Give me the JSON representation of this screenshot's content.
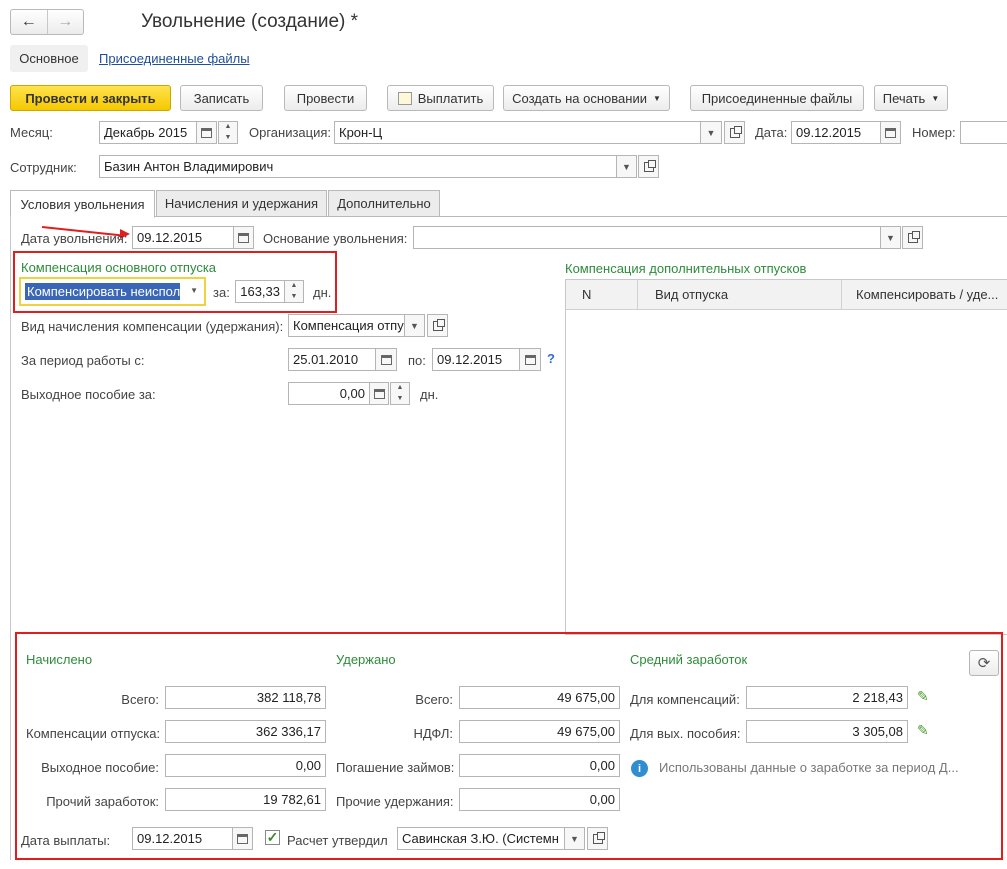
{
  "nav": {
    "back": "←",
    "forward": "→"
  },
  "title": "Увольнение (создание) *",
  "section_tabs": {
    "main": "Основное",
    "files": "Присоединенные файлы"
  },
  "toolbar": {
    "post_close": "Провести и закрыть",
    "save": "Записать",
    "post": "Провести",
    "pay": "Выплатить",
    "create_based": "Создать на основании",
    "attached_files": "Присоединенные файлы",
    "print": "Печать"
  },
  "header": {
    "month_label": "Месяц:",
    "month_value": "Декабрь 2015",
    "org_label": "Организация:",
    "org_value": "Крон-Ц",
    "date_label": "Дата:",
    "date_value": "09.12.2015",
    "number_label": "Номер:",
    "number_value": "",
    "employee_label": "Сотрудник:",
    "employee_value": "Базин Антон Владимирович"
  },
  "tabs": [
    "Условия увольнения",
    "Начисления и удержания",
    "Дополнительно"
  ],
  "conditions": {
    "dismissal_date_label": "Дата увольнения:",
    "dismissal_date_value": "09.12.2015",
    "basis_label": "Основание увольнения:",
    "basis_value": "",
    "main_vacation_title": "Компенсация основного отпуска",
    "compensate_value": "Компенсировать неиспол",
    "for_label": "за:",
    "days_value": "163,33",
    "days_unit": "дн.",
    "accrual_type_label": "Вид начисления компенсации (удержания):",
    "accrual_type_value": "Компенсация отпус",
    "period_from_label": "За период работы с:",
    "period_from_value": "25.01.2010",
    "period_to_label": "по:",
    "period_to_value": "09.12.2015",
    "help": "?",
    "severance_label": "Выходное пособие за:",
    "severance_value": "0,00",
    "severance_unit": "дн."
  },
  "extra_vacations": {
    "title": "Компенсация дополнительных отпусков",
    "columns": [
      "N",
      "Вид отпуска",
      "Компенсировать / уде..."
    ]
  },
  "accrued": {
    "title": "Начислено",
    "total_label": "Всего:",
    "total_value": "382 118,78",
    "vacation_label": "Компенсации отпуска:",
    "vacation_value": "362 336,17",
    "severance_label": "Выходное пособие:",
    "severance_value": "0,00",
    "other_label": "Прочий заработок:",
    "other_value": "19 782,61"
  },
  "withheld": {
    "title": "Удержано",
    "total_label": "Всего:",
    "total_value": "49 675,00",
    "ndfl_label": "НДФЛ:",
    "ndfl_value": "49 675,00",
    "loans_label": "Погашение займов:",
    "loans_value": "0,00",
    "other_label": "Прочие удержания:",
    "other_value": "0,00"
  },
  "average": {
    "title": "Средний заработок",
    "comp_label": "Для компенсаций:",
    "comp_value": "2 218,43",
    "sev_label": "Для вых. пособия:",
    "sev_value": "3 305,08",
    "info_text": "Использованы данные о заработке за период Д..."
  },
  "footer": {
    "pay_date_label": "Дата выплаты:",
    "pay_date_value": "09.12.2015",
    "approved_label": "Расчет утвердил",
    "approver_value": "Савинская З.Ю. (Системн"
  },
  "colors": {
    "accent_green": "#2e8b3a",
    "highlight_red": "#e01e1e",
    "primary_yellow": "#f5c800"
  }
}
